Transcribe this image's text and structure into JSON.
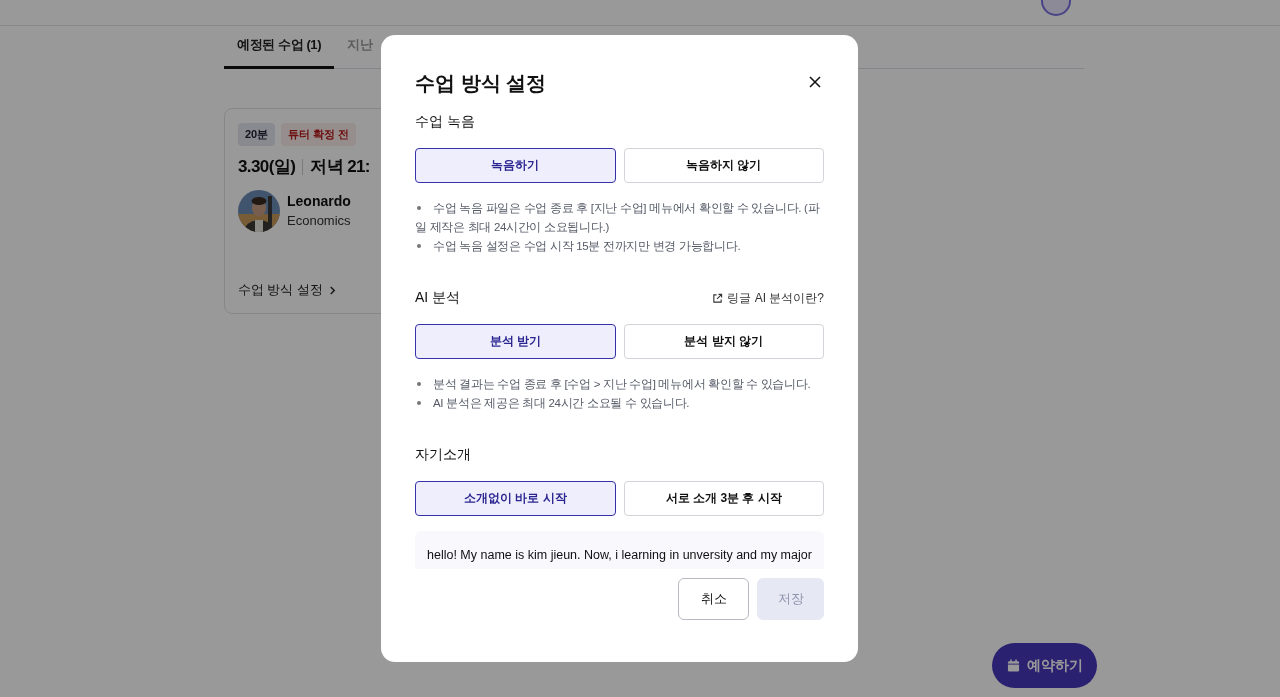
{
  "tabs": [
    {
      "label": "예정된 수업 (1)",
      "selected": true
    },
    {
      "label": "지난",
      "selected": false
    }
  ],
  "lesson_card": {
    "badges": [
      {
        "text": "20분",
        "kind": "duration"
      },
      {
        "text": "튜터 확정 전",
        "kind": "status"
      }
    ],
    "date": "3.30(일)",
    "time": "저녁 21:",
    "tutor": {
      "name": "Leonardo",
      "subject": "Economics"
    },
    "link": "수업 방식 설정"
  },
  "modal": {
    "title": "수업 방식 설정",
    "sections": [
      {
        "label": "수업 녹음",
        "options": [
          {
            "label": "녹음하기",
            "selected": true
          },
          {
            "label": "녹음하지 않기",
            "selected": false
          }
        ],
        "notes": [
          "수업 녹음 파일은 수업 종료 후 [지난 수업] 메뉴에서 확인할 수 있습니다. (파일 제작은 최대 24시간이 소요됩니다.)",
          "수업 녹음 설정은 수업 시작 15분 전까지만 변경 가능합니다."
        ]
      },
      {
        "label": "AI 분석",
        "link": "링글 AI 분석이란?",
        "options": [
          {
            "label": "분석 받기",
            "selected": true
          },
          {
            "label": "분석 받지 않기",
            "selected": false
          }
        ],
        "notes": [
          "분석 결과는 수업 종료 후 [수업 > 지난 수업] 메뉴에서 확인할 수 있습니다.",
          "AI 분석은 제공은 최대 24시간 소요될 수 있습니다."
        ]
      },
      {
        "label": "자기소개",
        "options": [
          {
            "label": "소개없이 바로 시작",
            "selected": true
          },
          {
            "label": "서로 소개 3분 후 시작",
            "selected": false
          }
        ],
        "intro": "hello! My name is kim jieun. Now, i learning in unversity and my major"
      }
    ],
    "buttons": [
      {
        "label": "취소",
        "disabled": false
      },
      {
        "label": "저장",
        "disabled": true
      }
    ]
  },
  "fab": {
    "label": "예약하기"
  }
}
